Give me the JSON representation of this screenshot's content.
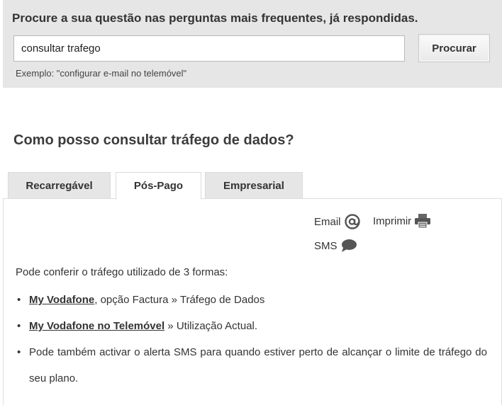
{
  "search": {
    "heading": "Procure a sua questão nas perguntas mais frequentes, já respondidas.",
    "query": "consultar trafego",
    "button_label": "Procurar",
    "example": "Exemplo: \"configurar e-mail no telemóvel\""
  },
  "page_title": "Como posso consultar tráfego de dados?",
  "tabs": [
    {
      "label": "Recarregável",
      "active": false
    },
    {
      "label": "Pós-Pago",
      "active": true
    },
    {
      "label": "Empresarial",
      "active": false
    }
  ],
  "tools": {
    "email_label": "Email",
    "print_label": "Imprimir",
    "sms_label": "SMS",
    "email_icon": "at-icon",
    "print_icon": "printer-icon",
    "sms_icon": "speech-bubble-icon"
  },
  "content": {
    "intro": "Pode conferir o tráfego utilizado de 3 formas:",
    "bullets": [
      {
        "link": "My Vodafone",
        "text": ", opção Factura » Tráfego de Dados"
      },
      {
        "link": "My Vodafone no Telemóvel",
        "text": " » Utilização Actual."
      },
      {
        "text": "Pode também activar o alerta SMS para quando estiver perto de alcançar o limite de tráfego do seu plano."
      }
    ]
  },
  "colors": {
    "panel_bg": "#e6e6e6",
    "text": "#333333",
    "icon": "#555555"
  }
}
